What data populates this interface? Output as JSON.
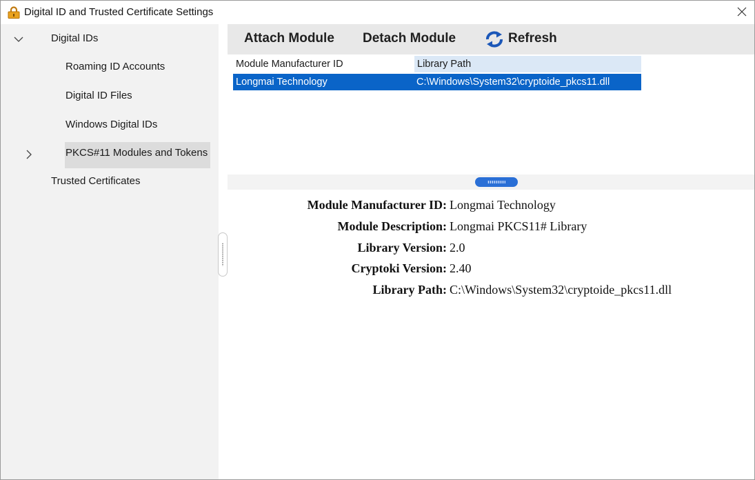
{
  "window": {
    "title": "Digital ID and Trusted Certificate Settings"
  },
  "icons": {
    "title": "lock-icon",
    "close": "close-icon",
    "expanded": "chevron-down-icon",
    "collapsed": "chevron-right-icon",
    "refresh": "refresh-icon"
  },
  "sidebar": {
    "digital_ids": "Digital IDs",
    "roaming_accounts": "Roaming ID Accounts",
    "digital_id_files": "Digital ID Files",
    "windows_digital_ids": "Windows Digital IDs",
    "pkcs11": "PKCS#11 Modules and Tokens",
    "trusted_certificates": "Trusted Certificates"
  },
  "toolbar": {
    "attach": "Attach Module",
    "detach": "Detach Module",
    "refresh": "Refresh"
  },
  "table": {
    "columns": [
      "Module Manufacturer ID",
      "Library Path"
    ],
    "rows": [
      [
        "Longmai Technology",
        "C:\\Windows\\System32\\cryptoide_pkcs11.dll"
      ]
    ]
  },
  "details": [
    {
      "label": "Module Manufacturer ID:",
      "value": "Longmai Technology"
    },
    {
      "label": "Module Description:",
      "value": "Longmai PKCS11# Library"
    },
    {
      "label": "Library Version:",
      "value": "2.0"
    },
    {
      "label": "Cryptoki Version:",
      "value": "2.40"
    },
    {
      "label": "Library Path:",
      "value": "C:\\Windows\\System32\\cryptoide_pkcs11.dll"
    }
  ],
  "colors": {
    "selection": "#0a64c8",
    "header_highlight": "#dbe8f6",
    "sidebar_bg": "#f2f2f2",
    "toolbar_bg": "#e8e8e8"
  }
}
